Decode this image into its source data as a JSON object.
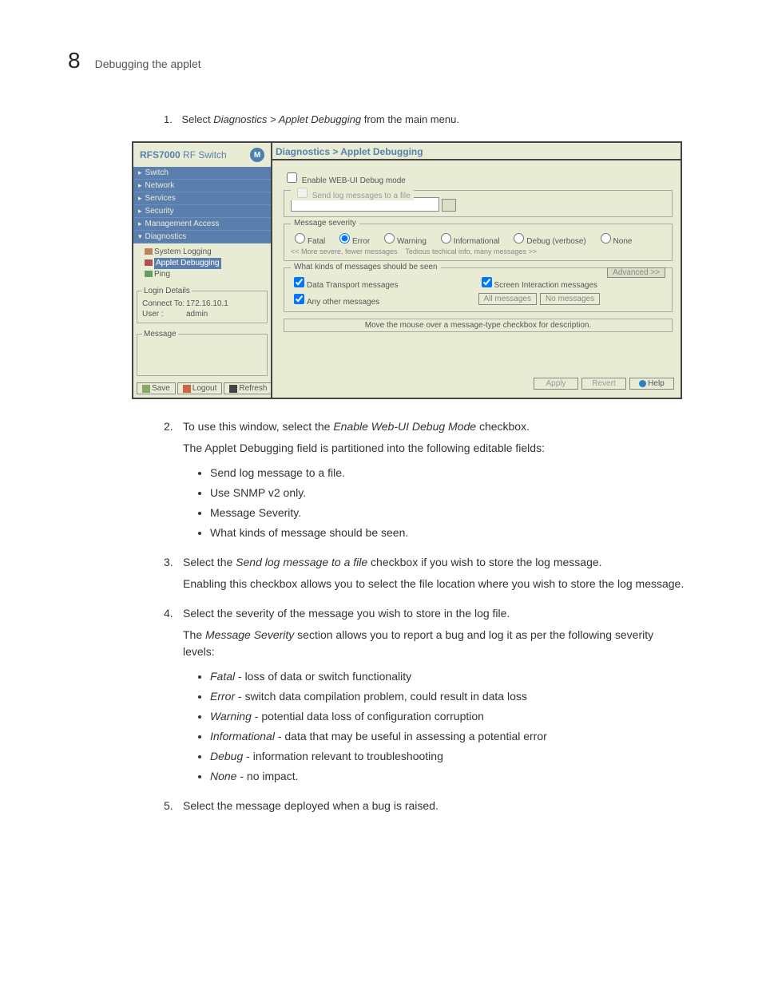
{
  "header": {
    "chapter": "8",
    "title": "Debugging the applet"
  },
  "step1": {
    "num": "1.",
    "prefix": "Select ",
    "path": "Diagnostics > Applet Debugging",
    "suffix": " from the main menu."
  },
  "shot": {
    "brand": {
      "model": "RFS7000",
      "kind": " RF Switch",
      "logo": "M"
    },
    "nav": {
      "switch": "Switch",
      "network": "Network",
      "services": "Services",
      "security": "Security",
      "mgmt": "Management Access",
      "diag": "Diagnostics"
    },
    "tree": {
      "syslog": "System Logging",
      "applet": "Applet Debugging",
      "ping": "Ping"
    },
    "login": {
      "legend": "Login Details",
      "connect_k": "Connect To:",
      "connect_v": "172.16.10.1",
      "user_k": "User :",
      "user_v": "admin"
    },
    "message_legend": "Message",
    "leftbtn": {
      "save": "Save",
      "logout": "Logout",
      "refresh": "Refresh"
    },
    "crumb": "Diagnostics > Applet Debugging",
    "enable": "Enable WEB-UI Debug mode",
    "sendfile": {
      "legend": "Send log messages to a file"
    },
    "sev": {
      "legend": "Message severity",
      "fatal": "Fatal",
      "error": "Error",
      "warning": "Warning",
      "info": "Informational",
      "debug": "Debug (verbose)",
      "none": "None",
      "left": "<< More severe, fewer messages",
      "right": "Tedious techical info, many messages >>"
    },
    "kinds": {
      "legend": "What kinds of messages should be seen",
      "adv": "Advanced >>",
      "data": "Data Transport messages",
      "screen": "Screen Interaction messages",
      "any": "Any other messages",
      "all_btn": "All messages",
      "no_btn": "No messages"
    },
    "hover": "Move the mouse over a message-type checkbox for description.",
    "bottom": {
      "apply": "Apply",
      "revert": "Revert",
      "help": "Help"
    }
  },
  "body": {
    "s2": {
      "num": "2.",
      "line": "To use this window, select the ",
      "em": "Enable Web-UI Debug Mode",
      "line2": " checkbox.",
      "p": "The Applet Debugging field is partitioned into the following editable fields:",
      "b1": "Send log message to a file.",
      "b2": "Use SNMP v2 only.",
      "b3": "Message Severity.",
      "b4": "What kinds of message should be seen."
    },
    "s3": {
      "num": "3.",
      "a": "Select the ",
      "em": "Send log message to a file",
      "b": " checkbox if you wish to store the log message.",
      "p": "Enabling this checkbox allows you to select the file location where you wish to store the log message."
    },
    "s4": {
      "num": "4.",
      "a": "Select the severity of the message you wish to store in the log file.",
      "p1a": "The ",
      "p1em": "Message Severity",
      "p1b": " section allows you to report a bug and log it as per the following severity levels:",
      "fatal_k": "Fatal",
      "fatal_v": " - loss of data or switch functionality",
      "error_k": "Error",
      "error_v": " - switch data compilation problem, could result in data loss",
      "warn_k": "Warning",
      "warn_v": " - potential data loss of configuration corruption",
      "info_k": "Informational",
      "info_v": " - data that may be useful in assessing a potential error",
      "debug_k": "Debug",
      "debug_v": " - information relevant to troubleshooting",
      "none_k": "None",
      "none_v": " - no impact."
    },
    "s5": {
      "num": "5.",
      "a": "Select the message deployed when a bug is raised."
    }
  }
}
